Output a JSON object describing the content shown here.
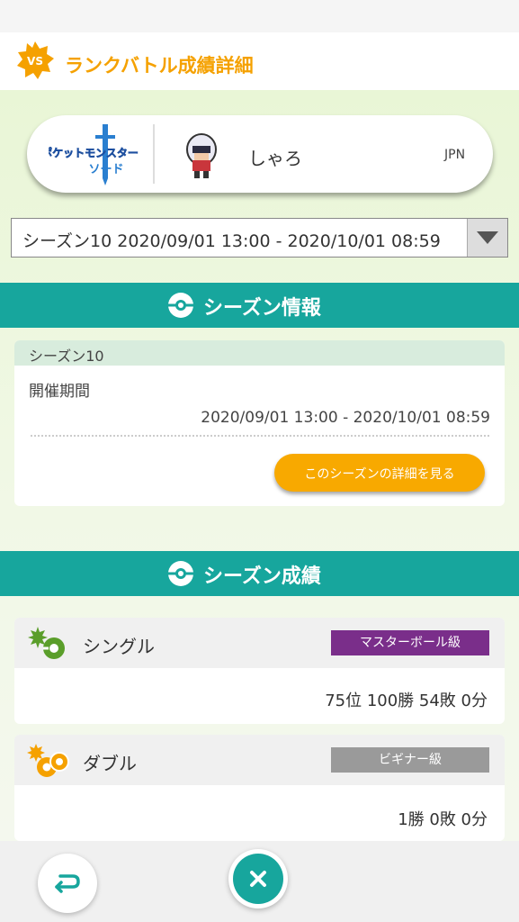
{
  "header": {
    "title": "ランクバトル成績詳細",
    "badge_text": "VS"
  },
  "profile": {
    "game_logo": {
      "line1": "ポケットモンスター",
      "line2": "ソード"
    },
    "avatar_icon": "trainer-sprite-icon",
    "name": "しゃろ",
    "country": "JPN"
  },
  "season_select": {
    "value": "シーズン10 2020/09/01 13:00 - 2020/10/01 08:59"
  },
  "season_info": {
    "title": "シーズン情報",
    "card_title": "シーズン10",
    "period_label": "開催期間",
    "period_value": "2020/09/01 13:00 - 2020/10/01 08:59",
    "detail_button": "このシーズンの詳細を見る"
  },
  "season_results": {
    "title": "シーズン成績",
    "modes": [
      {
        "label": "シングル",
        "rank": "マスターボール級",
        "rank_color": "#7a2e8a",
        "stats": "75位 100勝 54敗 0分"
      },
      {
        "label": "ダブル",
        "rank": "ビギナー級",
        "rank_color": "#9a9a9a",
        "stats": "1勝 0敗 0分"
      }
    ]
  },
  "colors": {
    "accent_orange": "#f5a100",
    "teal": "#17a69d"
  }
}
